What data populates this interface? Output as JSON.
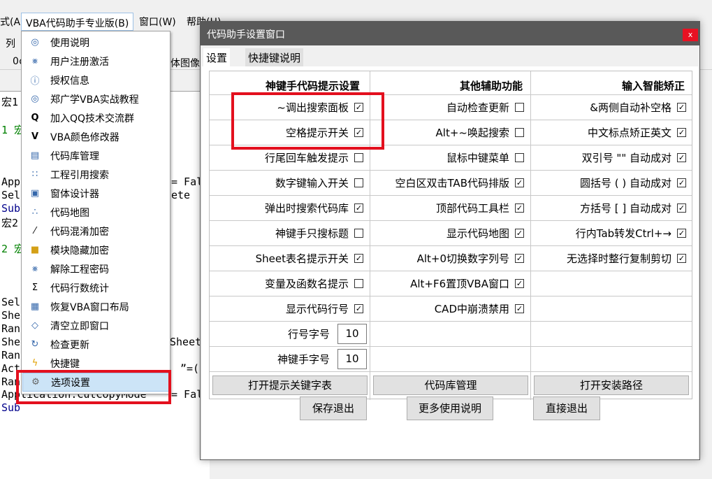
{
  "menubar": {
    "items": [
      "式(A)",
      "VBA代码助手专业版(B)",
      "窗口(W)",
      "帮助(H)"
    ]
  },
  "toolbar": {
    "t1": "列",
    "t2": "0¢",
    "t3": "体图像"
  },
  "code": {
    "lines": [
      "宏1",
      "1 宏",
      "App",
      "Sel",
      "Sub",
      "宏2",
      "2 宏",
      "Sel",
      "She",
      "Ran",
      "She",
      "Ran",
      "Act",
      "Ran",
      "Application.CutCopyMode",
      "Sub"
    ],
    "right_fragments": [
      "= Fal",
      "ete",
      "= Fal",
      "Sheet",
      "”=("
    ]
  },
  "dropdown": {
    "items": [
      {
        "label": "使用说明",
        "icon": "magnify-icon",
        "glyph": "◎"
      },
      {
        "label": "用户注册激活",
        "icon": "key-icon",
        "glyph": "⨳"
      },
      {
        "label": "授权信息",
        "icon": "info-icon",
        "glyph": "ⓘ"
      },
      {
        "label": "郑广学VBA实战教程",
        "icon": "magnify-icon",
        "glyph": "◎"
      },
      {
        "label": "加入QQ技术交流群",
        "icon": "q-icon",
        "glyph": "Q"
      },
      {
        "label": "VBA颜色修改器",
        "icon": "v-icon",
        "glyph": "V"
      },
      {
        "label": "代码库管理",
        "icon": "library-icon",
        "glyph": "▤"
      },
      {
        "label": "工程引用搜索",
        "icon": "tree-icon",
        "glyph": "∷"
      },
      {
        "label": "窗体设计器",
        "icon": "form-icon",
        "glyph": "▣"
      },
      {
        "label": "代码地图",
        "icon": "map-icon",
        "glyph": "∴"
      },
      {
        "label": "代码混淆加密",
        "icon": "obfuscate-icon",
        "glyph": "⁄"
      },
      {
        "label": "模块隐藏加密",
        "icon": "lock-icon",
        "glyph": "■"
      },
      {
        "label": "解除工程密码",
        "icon": "key-icon",
        "glyph": "⨳"
      },
      {
        "label": "代码行数统计",
        "icon": "sigma-icon",
        "glyph": "Σ"
      },
      {
        "label": "恢复VBA窗口布局",
        "icon": "window-layout-icon",
        "glyph": "▦"
      },
      {
        "label": "清空立即窗口",
        "icon": "eraser-icon",
        "glyph": "◇"
      },
      {
        "label": "检查更新",
        "icon": "update-icon",
        "glyph": "↻"
      },
      {
        "label": "快捷键",
        "icon": "lightning-icon",
        "glyph": "ϟ"
      },
      {
        "label": "选项设置",
        "icon": "settings-icon",
        "glyph": "⚙"
      }
    ]
  },
  "dialog": {
    "title": "代码助手设置窗口",
    "close": "x",
    "tabs": [
      "设置",
      "快捷键说明"
    ],
    "headers": [
      "神键手代码提示设置",
      "其他辅助功能",
      "输入智能矫正"
    ],
    "col1": [
      {
        "label": "~调出搜索面板",
        "checked": true
      },
      {
        "label": "空格提示开关",
        "checked": true
      },
      {
        "label": "行尾回车触发提示",
        "checked": false
      },
      {
        "label": "数字键输入开关",
        "checked": false
      },
      {
        "label": "弹出时搜索代码库",
        "checked": true
      },
      {
        "label": "神键手只搜标题",
        "checked": false
      },
      {
        "label": "Sheet表名提示开关",
        "checked": true
      },
      {
        "label": "变量及函数名提示",
        "checked": false
      },
      {
        "label": "显示代码行号",
        "checked": true
      }
    ],
    "col2": [
      {
        "label": "自动检查更新",
        "checked": false
      },
      {
        "label": "Alt+~唤起搜索",
        "checked": false
      },
      {
        "label": "鼠标中键菜单",
        "checked": false
      },
      {
        "label": "空白区双击TAB代码排版",
        "checked": true
      },
      {
        "label": "顶部代码工具栏",
        "checked": true
      },
      {
        "label": "显示代码地图",
        "checked": true
      },
      {
        "label": "Alt+0切换数字列号",
        "checked": true
      },
      {
        "label": "Alt+F6置顶VBA窗口",
        "checked": true
      },
      {
        "label": "CAD中崩溃禁用",
        "checked": true
      }
    ],
    "col3": [
      {
        "label": "&两侧自动补空格",
        "checked": true
      },
      {
        "label": "中文标点矫正英文",
        "checked": true
      },
      {
        "label": "双引号 \"\" 自动成对",
        "checked": true
      },
      {
        "label": "圆括号 ( ) 自动成对",
        "checked": true
      },
      {
        "label": "方括号 [ ] 自动成对",
        "checked": true
      },
      {
        "label": "行内Tab转发Ctrl+→",
        "checked": true
      },
      {
        "label": "无选择时整行复制剪切",
        "checked": true
      }
    ],
    "line_font_label": "行号字号",
    "line_font_value": "10",
    "god_font_label": "神键手字号",
    "god_font_value": "10",
    "grid_buttons": [
      "打开提示关键字表",
      "代码库管理",
      "打开安装路径"
    ],
    "footer_buttons": [
      "保存退出",
      "更多使用说明",
      "直接退出"
    ]
  },
  "colors": {
    "highlight": "#e3101e",
    "titlebar": "#595959",
    "close": "#e81123",
    "selected_item": "#cce4f7"
  }
}
